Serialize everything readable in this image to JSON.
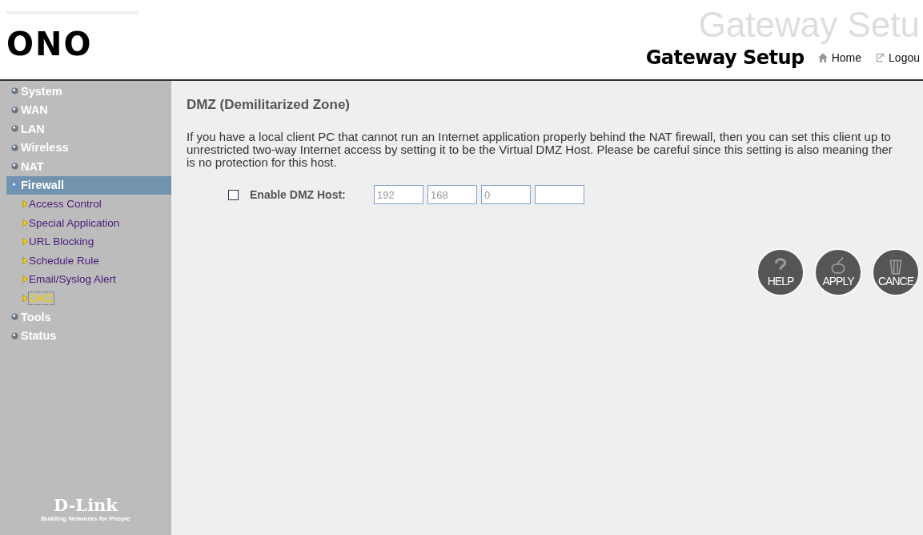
{
  "header": {
    "logo": "ONO",
    "watermark_title": "Gateway Setu",
    "title": "Gateway Setup",
    "links": [
      {
        "kind": "home",
        "label": "Home"
      },
      {
        "kind": "logout",
        "label": "Logou"
      }
    ]
  },
  "sidebar": {
    "items": [
      {
        "label": "System",
        "selected": false
      },
      {
        "label": "WAN",
        "selected": false
      },
      {
        "label": "LAN",
        "selected": false
      },
      {
        "label": "Wireless",
        "selected": false
      },
      {
        "label": "NAT",
        "selected": false
      },
      {
        "label": "Firewall",
        "selected": true,
        "children": [
          {
            "label": "Access Control",
            "selected": false
          },
          {
            "label": "Special Application",
            "selected": false
          },
          {
            "label": "URL Blocking",
            "selected": false
          },
          {
            "label": "Schedule Rule",
            "selected": false
          },
          {
            "label": "Email/Syslog Alert",
            "selected": false
          },
          {
            "label": "DMZ",
            "selected": true
          }
        ]
      },
      {
        "label": "Tools",
        "selected": false
      },
      {
        "label": "Status",
        "selected": false
      }
    ],
    "brand": "D-Link",
    "tagline": "Building Networks for People"
  },
  "main": {
    "heading": "DMZ (Demilitarized Zone)",
    "description": "If you have a local client PC that cannot run an Internet application properly behind the NAT firewall, then you can set this client up to unrestricted two-way Internet access by setting it to be the Virtual DMZ Host. Please be careful since this setting is also meaning ther is no protection for this host.",
    "enable": {
      "label": "Enable DMZ Host:",
      "checked": false
    },
    "ip_fields": [
      {
        "kind": "filled",
        "value": "192"
      },
      {
        "kind": "filled",
        "value": "168"
      },
      {
        "kind": "filled",
        "value": "0"
      },
      {
        "kind": "blank"
      }
    ],
    "buttons": [
      {
        "kind": "help",
        "label": "HELP"
      },
      {
        "kind": "apply",
        "label": "APPLY"
      },
      {
        "kind": "cancel",
        "label": "CANCE"
      }
    ]
  }
}
